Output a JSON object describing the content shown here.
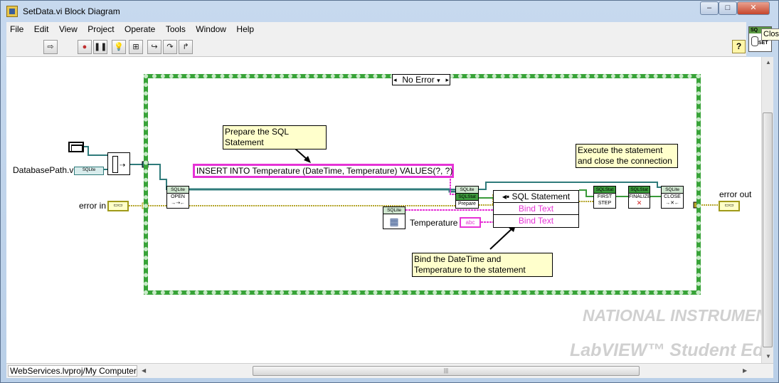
{
  "window": {
    "title": "SetData.vi Block Diagram",
    "controls": {
      "minimize": "–",
      "maximize": "□",
      "close": "✕"
    }
  },
  "menu": [
    "File",
    "Edit",
    "View",
    "Project",
    "Operate",
    "Tools",
    "Window",
    "Help"
  ],
  "toolbar": {
    "help": "?"
  },
  "tooltip": "Clos",
  "conn_icon": {
    "top": "SQ",
    "bottom": "SET"
  },
  "diagram": {
    "database_path_label": "DatabasePath.vi",
    "sqlite_badge": "SQLite",
    "error_in_label": "error in",
    "error_out_label": "error out",
    "case_selector": "No Error",
    "sql_string": "INSERT INTO Temperature (DateTime, Temperature) VALUES(?, ?)",
    "temperature_label": "Temperature",
    "temperature_type": "abc",
    "invoke_header": "SQL Statement",
    "invoke_rows": [
      "Bind Text",
      "Bind Text"
    ],
    "notes": {
      "prepare": "Prepare the SQL Statement",
      "execute": "Execute the statement and close the connection",
      "bind": "Bind the DateTime and Temperature to the statement"
    },
    "nodes": {
      "open": {
        "hdr": "SQLite",
        "label": "OPEN"
      },
      "prepare": {
        "hdr": "SQLite",
        "hdr2": "SQLStat",
        "label": "Prepare"
      },
      "first_step": {
        "hdr": "SQLStat",
        "label": "FIRST STEP"
      },
      "finalize": {
        "hdr": "SQLStat",
        "label": "FINALIZE"
      },
      "close": {
        "hdr": "SQLite",
        "label": "CLOSE"
      },
      "datetime": {
        "hdr": "SQLite"
      }
    }
  },
  "watermark": {
    "brand": "NATIONAL INSTRUMENTS",
    "product": "LabVIEW™ Student Edition"
  },
  "status": {
    "path": "WebServices.lvproj/My Computer"
  }
}
